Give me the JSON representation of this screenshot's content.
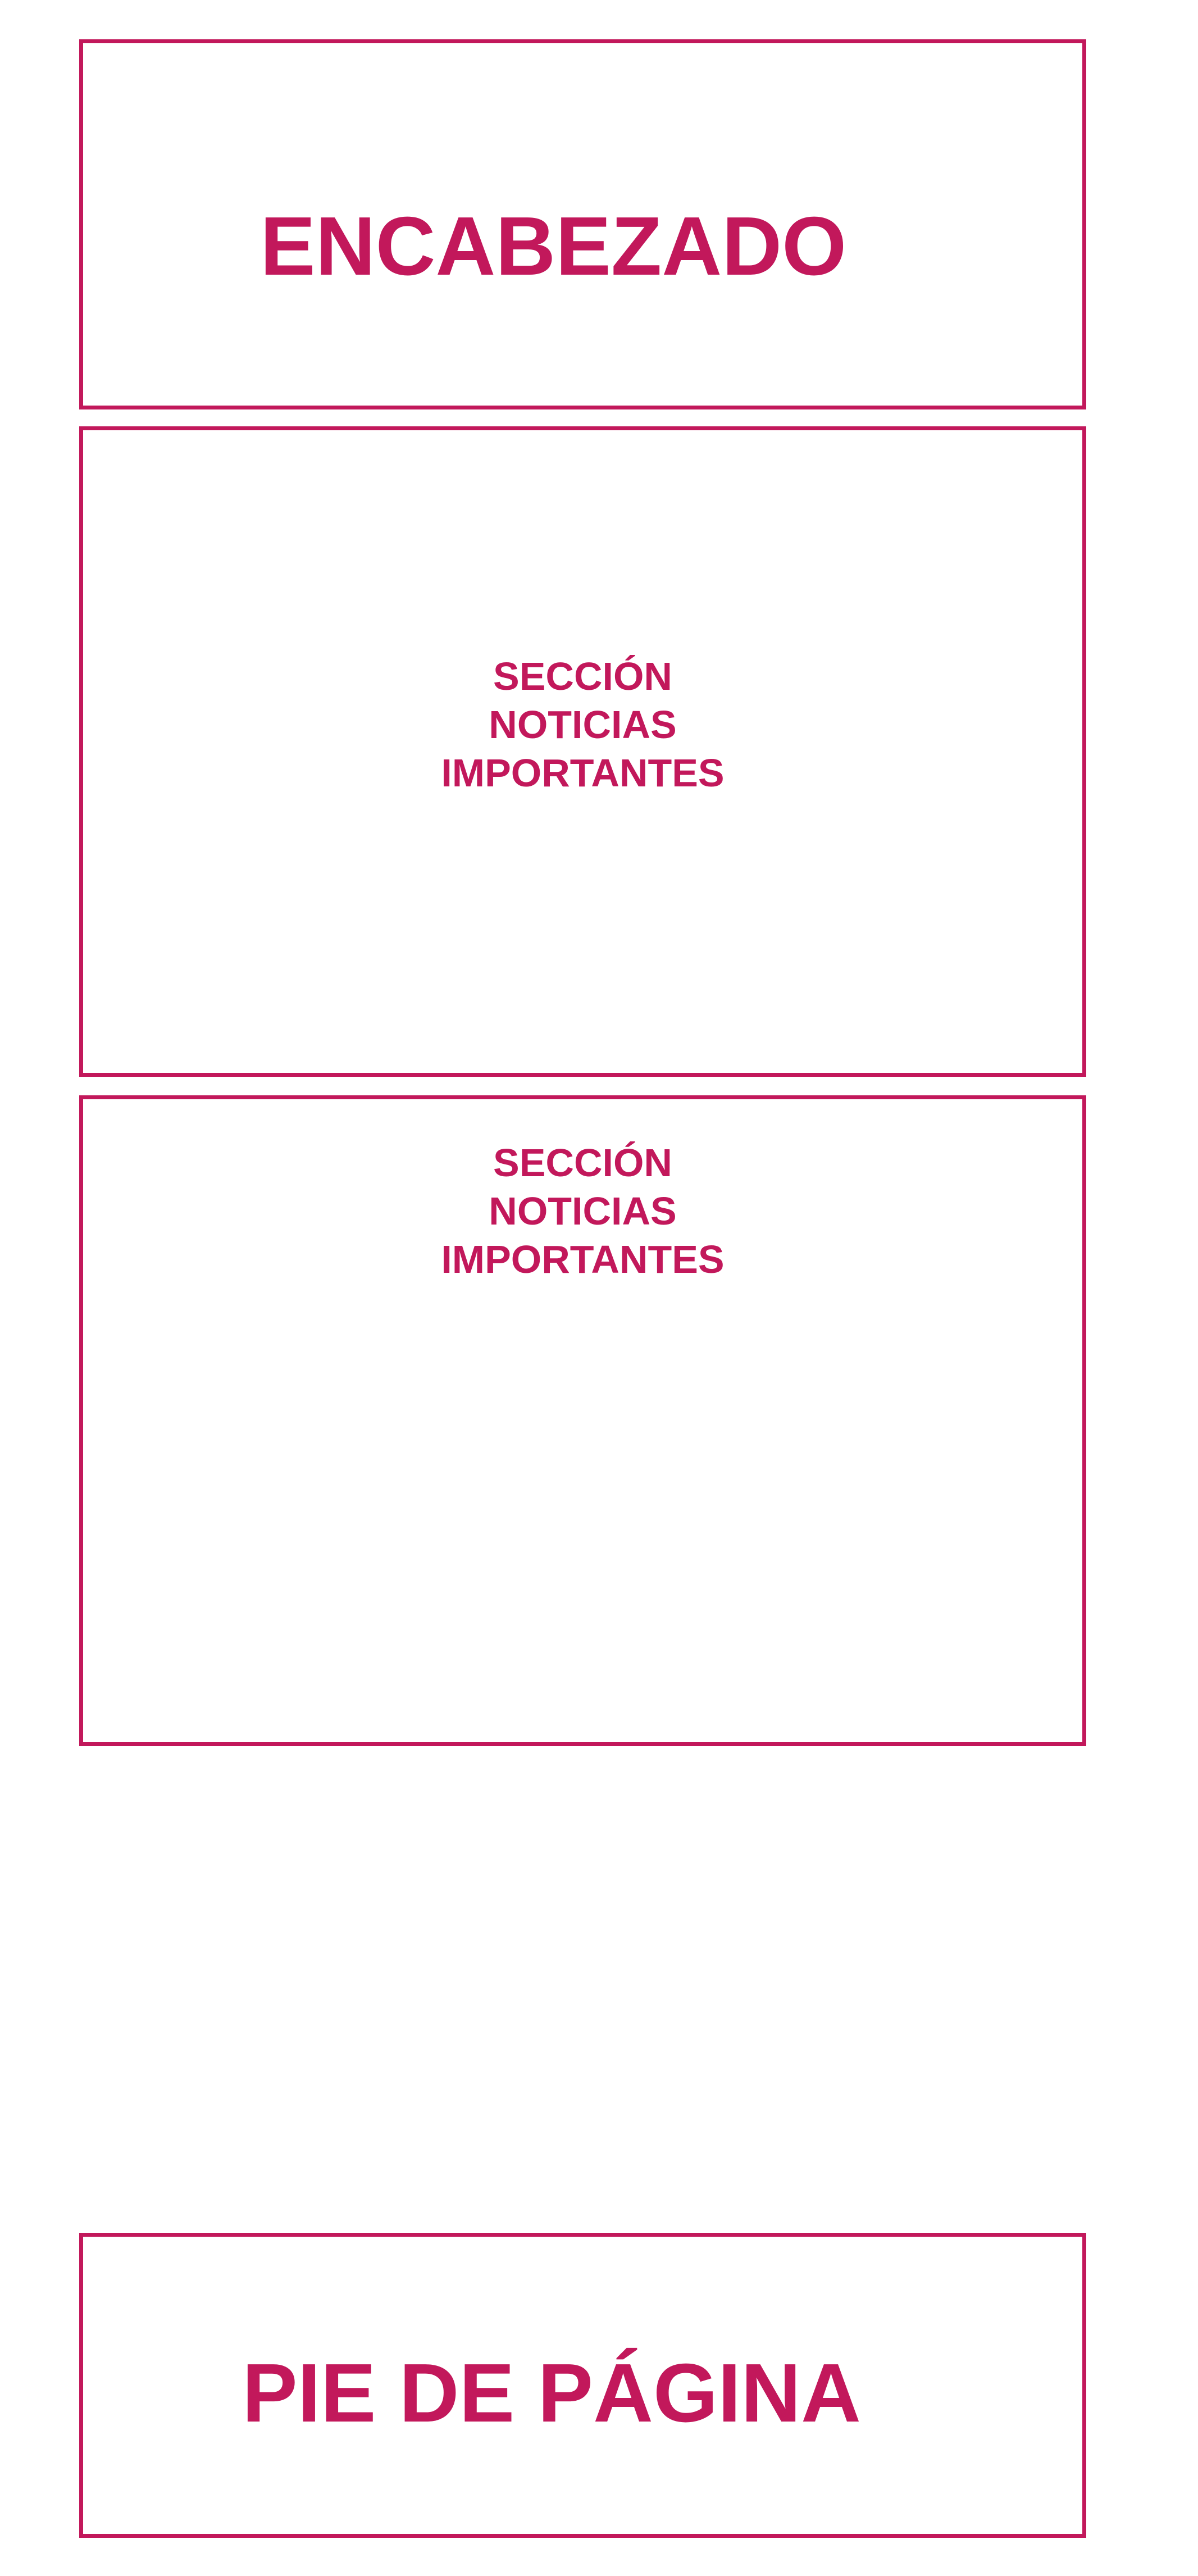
{
  "header": {
    "label": "ENCABEZADO"
  },
  "sections": [
    {
      "line1": "SECCIÓN",
      "line2": "NOTICIAS",
      "line3": "IMPORTANTES"
    },
    {
      "line1": "SECCIÓN",
      "line2": "NOTICIAS",
      "line3": "IMPORTANTES"
    }
  ],
  "footer": {
    "label": "PIE DE PÁGINA"
  },
  "colors": {
    "accent": "#c2185b",
    "background": "#ffffff"
  }
}
